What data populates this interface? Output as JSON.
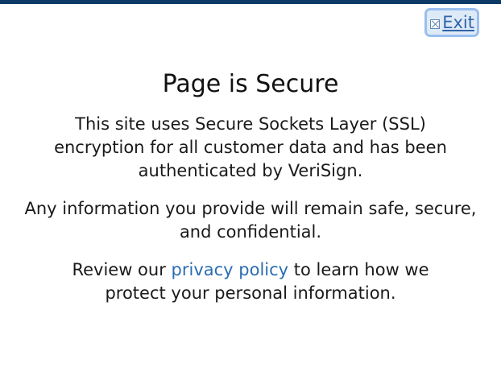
{
  "header": {
    "exit_label": "Exit",
    "exit_icon": "close-box-icon"
  },
  "main": {
    "title": "Page is Secure",
    "paragraph_1": "This site uses Secure Sockets Layer (SSL) encryption for all customer data and has been authenticated by VeriSign.",
    "paragraph_2": "Any information you provide will remain safe, secure, and confidential.",
    "paragraph_3": {
      "before": "Review our ",
      "link": "privacy policy",
      "after": " to learn how we protect your personal information."
    }
  },
  "colors": {
    "top_bar": "#0b3a66",
    "link": "#2a6db2",
    "exit_text": "#2f66aa"
  }
}
